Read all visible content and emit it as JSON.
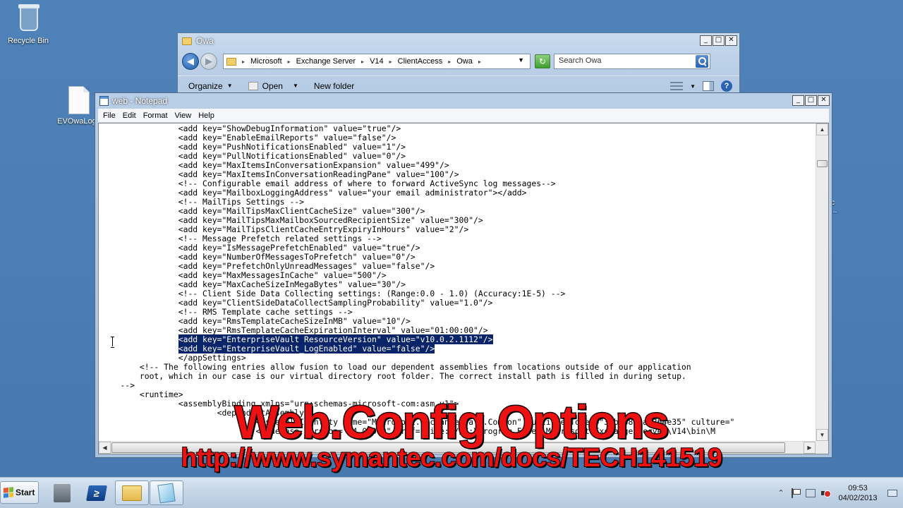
{
  "desktop": {
    "recycle_bin_label": "Recycle Bin",
    "file_label": "EVOwaLog_",
    "right_stub_text": "c\n..."
  },
  "explorer": {
    "title": "Owa",
    "window_buttons": [
      "_",
      "□",
      "✕"
    ],
    "breadcrumb": [
      "Microsoft",
      "Exchange Server",
      "V14",
      "ClientAccess",
      "Owa"
    ],
    "search_placeholder": "Search Owa",
    "toolbar": {
      "organize": "Organize",
      "open": "Open",
      "new_folder": "New folder"
    }
  },
  "notepad": {
    "title": "web - Notepad",
    "window_buttons": [
      "_",
      "□",
      "✕"
    ],
    "menu": [
      "File",
      "Edit",
      "Format",
      "View",
      "Help"
    ],
    "lines": [
      "                <add key=\"ShowDebugInformation\" value=\"true\"/>",
      "                <add key=\"EnableEmailReports\" value=\"false\"/>",
      "                <add key=\"PushNotificationsEnabled\" value=\"1\"/>",
      "                <add key=\"PullNotificationsEnabled\" value=\"0\"/>",
      "                <add key=\"MaxItemsInConversationExpansion\" value=\"499\"/>",
      "                <add key=\"MaxItemsInConversationReadingPane\" value=\"100\"/>",
      "                <!-- Configurable email address of where to forward ActiveSync log messages-->",
      "                <add key=\"MailboxLoggingAddress\" value=\"your email administrator\"></add>",
      "                <!-- MailTips Settings -->",
      "                <add key=\"MailTipsMaxClientCacheSize\" value=\"300\"/>",
      "                <add key=\"MailTipsMaxMailboxSourcedRecipientSize\" value=\"300\"/>",
      "                <add key=\"MailTipsClientCacheEntryExpiryInHours\" value=\"2\"/>",
      "                <!-- Message Prefetch related settings -->",
      "                <add key=\"IsMessagePrefetchEnabled\" value=\"true\"/>",
      "                <add key=\"NumberOfMessagesToPrefetch\" value=\"0\"/>",
      "                <add key=\"PrefetchOnlyUnreadMessages\" value=\"false\"/>",
      "                <add key=\"MaxMessagesInCache\" value=\"500\"/>",
      "                <add key=\"MaxCacheSizeInMegaBytes\" value=\"30\"/>",
      "                <!-- Client Side Data Collecting settings: (Range:0.0 - 1.0) (Accuracy:1E-5) -->",
      "                <add key=\"ClientSideDataCollectSamplingProbability\" value=\"1.0\"/>",
      "                <!-- RMS Template cache settings -->",
      "                <add key=\"RmsTemplateCacheSizeInMB\" value=\"10\"/>",
      "                <add key=\"RmsTemplateCacheExpirationInterval\" value=\"01:00:00\"/>",
      "                <add key=\"EnterpriseVault_ResourceVersion\" value=\"v10.0.2.1112\"/>",
      "                <add key=\"EnterpriseVault_LogEnabled\" value=\"false\"/>",
      "                </appSettings>",
      "        <!-- The following entries allow fusion to load our dependent assemblies from locations outside of our application",
      "        root, which in our case is our virtual directory root folder. The correct install path is filled in during setup.",
      "    -->",
      "        <runtime>",
      "                <assemblyBinding xmlns=\"urn:schemas-microsoft-com:asm.v1\">",
      "                        <dependentAssembly>",
      "                                <assemblyIdentity name=\"Microsoft.Exchange.Data.Common\" publicKeyToken=\"31bf3856ad364e35\" culture=\"",
      "                                <codeBase version=\"14.0.0.0\" href=\"file:///C:\\Program Files\\Microsoft\\Exchange Server\\V14\\bin\\M"
    ],
    "selected_lines": [
      23,
      24
    ]
  },
  "overlay": {
    "title": "Web.Config Options",
    "url": "http://www.symantec.com/docs/TECH141519"
  },
  "taskbar": {
    "start_label": "Start",
    "clock_time": "09:53",
    "clock_date": "04/02/2013"
  }
}
